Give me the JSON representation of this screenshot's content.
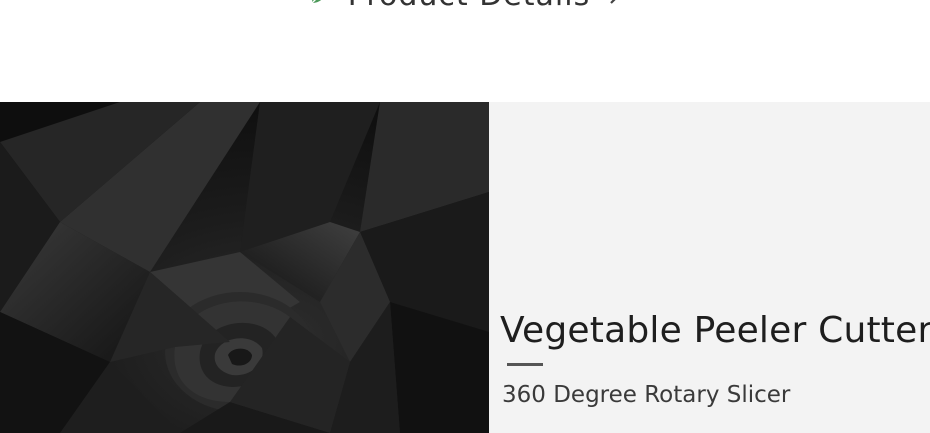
{
  "header": {
    "title": "Product Details",
    "leaf_icon": "leaf-icon",
    "arrow_icon": "chevron-right-icon",
    "accent_color": "#4c9a5a"
  },
  "feature": {
    "image": "black-fabric-image",
    "title": "Vegetable Peeler Cutter",
    "subtitle": "360 Degree Rotary Slicer",
    "panel_color": "#f3f3f3"
  }
}
